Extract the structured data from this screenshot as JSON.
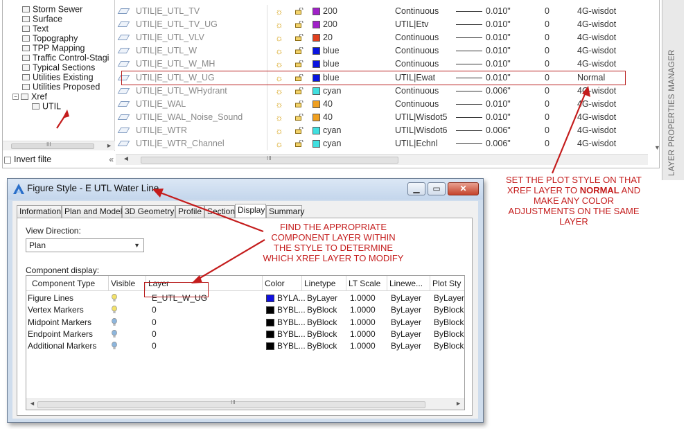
{
  "layer_manager": {
    "panel_title": "LAYER PROPERTIES MANAGER",
    "tree_items": [
      {
        "label": "Storm Sewer"
      },
      {
        "label": "Surface"
      },
      {
        "label": "Text"
      },
      {
        "label": "Topography"
      },
      {
        "label": "TPP Mapping"
      },
      {
        "label": "Traffic Control-Stagi"
      },
      {
        "label": "Typical Sections"
      },
      {
        "label": "Utilities Existing"
      },
      {
        "label": "Utilities Proposed"
      }
    ],
    "xref_label": "Xref",
    "xref_toggle": "−",
    "util_label": "UTIL",
    "invert_filter_label": "Invert filte",
    "collapse_glyph": "«",
    "scroll_grip": "III",
    "layers": [
      {
        "name": "UTIL|E_UTL_TV",
        "color_hex": "#a020c8",
        "color": "200",
        "linetype": "Continuous",
        "lineweight": "0.010\"",
        "transparency": "0",
        "plot_style": "4G-wisdot"
      },
      {
        "name": "UTIL|E_UTL_TV_UG",
        "color_hex": "#a020c8",
        "color": "200",
        "linetype": "UTIL|Etv",
        "lineweight": "0.010\"",
        "transparency": "0",
        "plot_style": "4G-wisdot"
      },
      {
        "name": "UTIL|E_UTL_VLV",
        "color_hex": "#e0401e",
        "color": "20",
        "linetype": "Continuous",
        "lineweight": "0.010\"",
        "transparency": "0",
        "plot_style": "4G-wisdot"
      },
      {
        "name": "UTIL|E_UTL_W",
        "color_hex": "#0a14e0",
        "color": "blue",
        "linetype": "Continuous",
        "lineweight": "0.010\"",
        "transparency": "0",
        "plot_style": "4G-wisdot"
      },
      {
        "name": "UTIL|E_UTL_W_MH",
        "color_hex": "#0a14e0",
        "color": "blue",
        "linetype": "Continuous",
        "lineweight": "0.010\"",
        "transparency": "0",
        "plot_style": "4G-wisdot"
      },
      {
        "name": "UTIL|E_UTL_W_UG",
        "color_hex": "#0a14e0",
        "color": "blue",
        "linetype": "UTIL|Ewat",
        "lineweight": "0.010\"",
        "transparency": "0",
        "plot_style": "Normal"
      },
      {
        "name": "UTIL|E_UTL_WHydrant",
        "color_hex": "#40e0e0",
        "color": "cyan",
        "linetype": "Continuous",
        "lineweight": "0.006\"",
        "transparency": "0",
        "plot_style": "4G-wisdot"
      },
      {
        "name": "UTIL|E_WAL",
        "color_hex": "#f0a020",
        "color": "40",
        "linetype": "Continuous",
        "lineweight": "0.010\"",
        "transparency": "0",
        "plot_style": "4G-wisdot"
      },
      {
        "name": "UTIL|E_WAL_Noise_Sound",
        "color_hex": "#f0a020",
        "color": "40",
        "linetype": "UTIL|Wisdot5",
        "lineweight": "0.010\"",
        "transparency": "0",
        "plot_style": "4G-wisdot"
      },
      {
        "name": "UTIL|E_WTR",
        "color_hex": "#40e0e0",
        "color": "cyan",
        "linetype": "UTIL|Wisdot6",
        "lineweight": "0.006\"",
        "transparency": "0",
        "plot_style": "4G-wisdot"
      },
      {
        "name": "UTIL|E_WTR_Channel",
        "color_hex": "#40e0e0",
        "color": "cyan",
        "linetype": "UTIL|Echnl",
        "lineweight": "0.006\"",
        "transparency": "0",
        "plot_style": "4G-wisdot"
      }
    ],
    "sun_glyph": "☼"
  },
  "dialog": {
    "title": "Figure Style - E UTL Water Line",
    "min_glyph": "▁",
    "max_glyph": "▭",
    "close_glyph": "✕",
    "tabs": [
      "Information",
      "Plan and Model",
      "3D Geometry",
      "Profile",
      "Section",
      "Display",
      "Summary"
    ],
    "active_tab": "Display",
    "view_direction_label": "View Direction:",
    "view_direction_value": "Plan",
    "component_display_label": "Component display:",
    "columns": [
      "Component Type",
      "Visible",
      "Layer",
      "Color",
      "Linetype",
      "LT Scale",
      "Linewe...",
      "Plot Sty"
    ],
    "rows": [
      {
        "type": "Figure Lines",
        "bulb_color": "#f3e26a",
        "layer": "E_UTL_W_UG",
        "color_hex": "#1010e0",
        "color": "BYLA...",
        "linetype": "ByLayer",
        "lt_scale": "1.0000",
        "lineweight": "ByLayer",
        "plot_style": "ByLayer"
      },
      {
        "type": "Vertex Markers",
        "bulb_color": "#f3e26a",
        "layer": "0",
        "color_hex": "#000000",
        "color": "BYBL...",
        "linetype": "ByBlock",
        "lt_scale": "1.0000",
        "lineweight": "ByLayer",
        "plot_style": "ByBlock"
      },
      {
        "type": "Midpoint Markers",
        "bulb_color": "#8db6dd",
        "layer": "0",
        "color_hex": "#000000",
        "color": "BYBL...",
        "linetype": "ByBlock",
        "lt_scale": "1.0000",
        "lineweight": "ByLayer",
        "plot_style": "ByBlock"
      },
      {
        "type": "Endpoint Markers",
        "bulb_color": "#8db6dd",
        "layer": "0",
        "color_hex": "#000000",
        "color": "BYBL...",
        "linetype": "ByBlock",
        "lt_scale": "1.0000",
        "lineweight": "ByLayer",
        "plot_style": "ByBlock"
      },
      {
        "type": "Additional Markers",
        "bulb_color": "#8db6dd",
        "layer": "0",
        "color_hex": "#000000",
        "color": "BYBL...",
        "linetype": "ByBlock",
        "lt_scale": "1.0000",
        "lineweight": "ByLayer",
        "plot_style": "ByBlock"
      }
    ]
  },
  "annotations": {
    "find_note": [
      "FIND THE APPROPRIATE",
      "COMPONENT LAYER WITHIN",
      "THE STYLE TO DETERMINE",
      "WHICH XREF LAYER TO MODIFY"
    ],
    "plot_note_line1": "SET THE PLOT STYLE ON THAT",
    "plot_note_line2_pre": "XREF LAYER TO ",
    "plot_note_line2_bold": "NORMAL",
    "plot_note_line2_post": " AND",
    "plot_note_rest": [
      "MAKE ANY COLOR",
      "ADJUSTMENTS ON THE SAME",
      "LAYER"
    ],
    "annotation_color": "#c41c1c"
  }
}
